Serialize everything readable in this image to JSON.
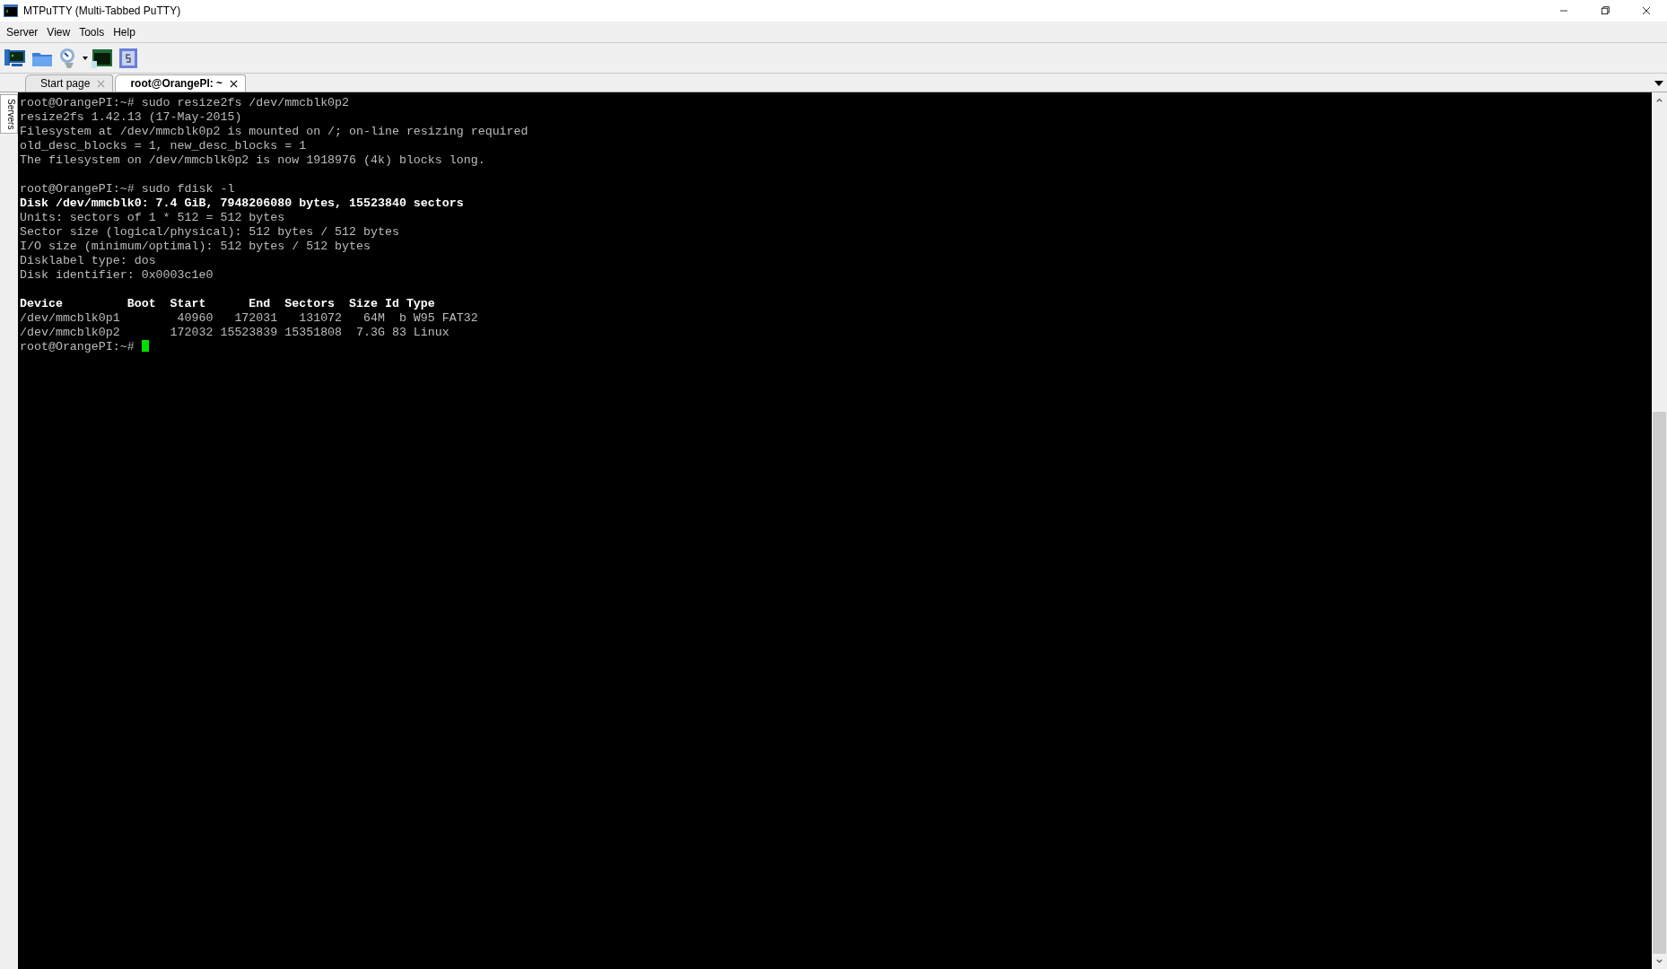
{
  "window": {
    "title": "MTPuTTY (Multi-Tabbed PuTTY)"
  },
  "menu": [
    "Server",
    "View",
    "Tools",
    "Help"
  ],
  "sidebar_tab": {
    "label": "Servers"
  },
  "tabs": [
    {
      "label": "Start page",
      "selected": false
    },
    {
      "label": "root@OrangePI: ~",
      "selected": true
    }
  ],
  "terminal": {
    "lines": [
      {
        "kind": "text",
        "text": "root@OrangePI:~# sudo resize2fs /dev/mmcblk0p2"
      },
      {
        "kind": "text",
        "text": "resize2fs 1.42.13 (17-May-2015)"
      },
      {
        "kind": "text",
        "text": "Filesystem at /dev/mmcblk0p2 is mounted on /; on-line resizing required"
      },
      {
        "kind": "text",
        "text": "old_desc_blocks = 1, new_desc_blocks = 1"
      },
      {
        "kind": "text",
        "text": "The filesystem on /dev/mmcblk0p2 is now 1918976 (4k) blocks long."
      },
      {
        "kind": "blank"
      },
      {
        "kind": "text",
        "text": "root@OrangePI:~# sudo fdisk -l"
      },
      {
        "kind": "bold",
        "text": "Disk /dev/mmcblk0: 7.4 GiB, 7948206080 bytes, 15523840 sectors"
      },
      {
        "kind": "text",
        "text": "Units: sectors of 1 * 512 = 512 bytes"
      },
      {
        "kind": "text",
        "text": "Sector size (logical/physical): 512 bytes / 512 bytes"
      },
      {
        "kind": "text",
        "text": "I/O size (minimum/optimal): 512 bytes / 512 bytes"
      },
      {
        "kind": "text",
        "text": "Disklabel type: dos"
      },
      {
        "kind": "text",
        "text": "Disk identifier: 0x0003c1e0"
      },
      {
        "kind": "blank"
      },
      {
        "kind": "bold",
        "text": "Device         Boot  Start      End  Sectors  Size Id Type"
      },
      {
        "kind": "text",
        "text": "/dev/mmcblk0p1        40960   172031   131072   64M  b W95 FAT32"
      },
      {
        "kind": "text",
        "text": "/dev/mmcblk0p2       172032 15523839 15351808  7.3G 83 Linux"
      },
      {
        "kind": "prompt",
        "text": "root@OrangePI:~# "
      }
    ]
  }
}
